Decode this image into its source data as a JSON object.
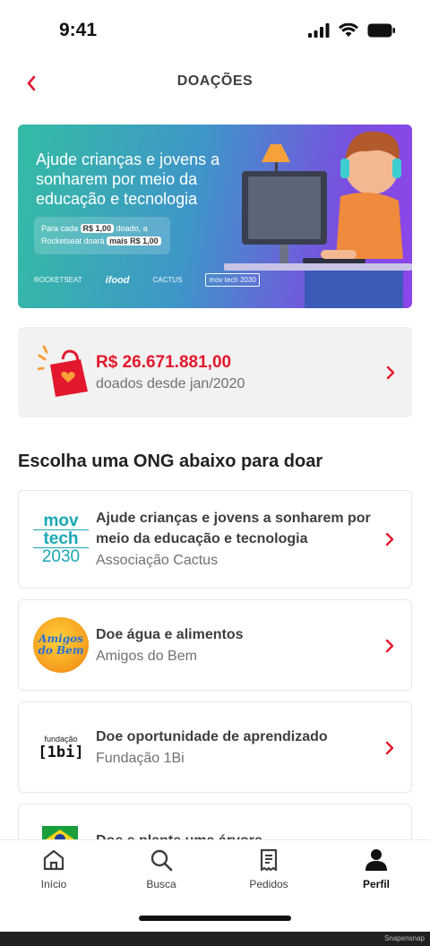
{
  "status_bar": {
    "time": "9:41"
  },
  "header": {
    "title": "DOAÇÕES"
  },
  "banner": {
    "headline": "Ajude crianças e jovens a sonharem por meio da educação e tecnologia",
    "pill_prefix": "Para cada",
    "pill_amount": "R$ 1,00",
    "pill_middle": "doado, a Rocketseat doará",
    "pill_bonus": "mais R$ 1,00",
    "logos": [
      "ROCKETSEAT",
      "ifood",
      "CACTUS",
      "mov tech 2030"
    ]
  },
  "summary": {
    "amount": "R$ 26.671.881,00",
    "subtitle": "doados desde jan/2020"
  },
  "section_title": "Escolha uma ONG abaixo para doar",
  "ongs": [
    {
      "title": "Ajude crianças e jovens a sonharem por meio da educação e tecnologia",
      "org": "Associação Cactus",
      "logo": "movtech-logo"
    },
    {
      "title": "Doe água e alimentos",
      "org": "Amigos do Bem",
      "logo": "amigos-do-bem-logo"
    },
    {
      "title": "Doe oportunidade de aprendizado",
      "org": "Fundação 1Bi",
      "logo": "fundacao-1bi-logo"
    },
    {
      "title": "Doe e plante uma árvore",
      "org": "",
      "logo": "tree-logo"
    }
  ],
  "logo_text": {
    "movtech_line1": "mov",
    "movtech_line2": "tech",
    "movtech_line3": "2030",
    "amigos_line1": "Amigos",
    "amigos_line2": "do Bem",
    "fundacao_line1": "fundação",
    "fundacao_line2": "[1bi]"
  },
  "tabs": [
    {
      "label": "Início",
      "icon": "home-icon"
    },
    {
      "label": "Busca",
      "icon": "search-icon"
    },
    {
      "label": "Pedidos",
      "icon": "receipt-icon"
    },
    {
      "label": "Perfil",
      "icon": "user-icon",
      "active": true
    }
  ],
  "watermark": "Snapensnap",
  "colors": {
    "accent": "#e3182d",
    "text": "#3e3e3e",
    "muted": "#717171"
  }
}
